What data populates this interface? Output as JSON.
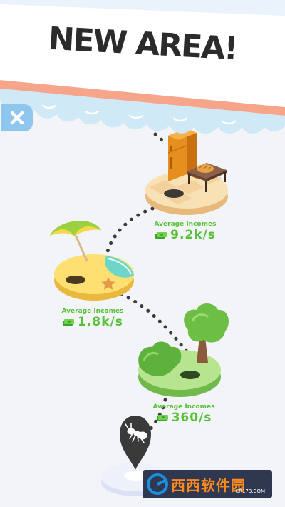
{
  "banner": {
    "title": "NEW AREA!",
    "close_icon": "close-icon",
    "colors": {
      "stripe": "#f6a58a",
      "cloud": "#cfe9f7",
      "close_bg": "#8ec6ee"
    }
  },
  "areas": [
    {
      "name": "kitchen",
      "label": "Average Incomes",
      "value": "9.2k/s",
      "icon": "cash-icon"
    },
    {
      "name": "beach",
      "label": "Average Incomes",
      "value": "1.8k/s",
      "icon": "cash-icon"
    },
    {
      "name": "forest",
      "label": "Average Incomes",
      "value": "360/s",
      "icon": "cash-icon"
    }
  ],
  "current_location": {
    "icon": "ant-map-pin-icon"
  },
  "watermark": {
    "text": "西西软件园",
    "url": "CR173.COM"
  },
  "colors": {
    "income": "#58bf3a",
    "path": "#3a3a3a"
  }
}
